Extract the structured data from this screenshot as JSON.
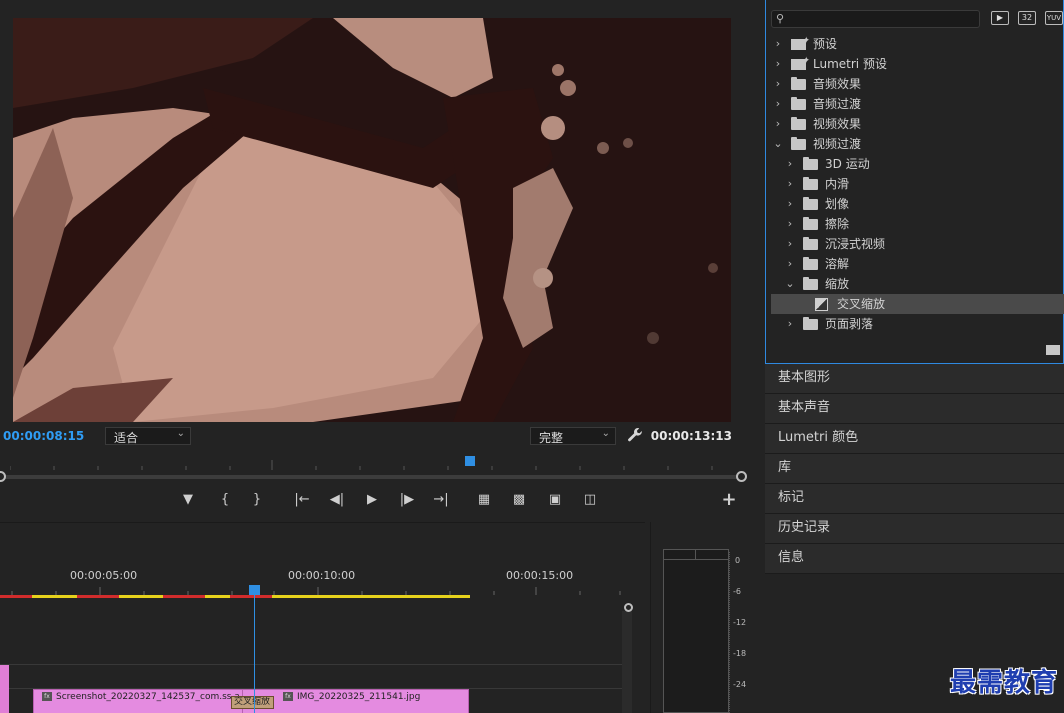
{
  "monitor": {
    "current_timecode": "00:00:08:15",
    "fit_select": "适合",
    "resolution_select": "完整",
    "duration_timecode": "00:00:13:13"
  },
  "controls": [
    "marker-icon",
    "mark-in-icon",
    "mark-out-icon",
    "go-to-in-icon",
    "step-back-icon",
    "play-icon",
    "step-forward-icon",
    "go-to-out-icon",
    "lift-icon",
    "extract-icon",
    "camera-icon",
    "compare-icon",
    "add-icon"
  ],
  "effects_panel": {
    "search_placeholder": "",
    "buttons": [
      "32-bit",
      "32",
      "YUV"
    ],
    "tree": [
      {
        "label": "预设",
        "expanded": false,
        "level": 0,
        "icon": "preset"
      },
      {
        "label": "Lumetri 预设",
        "expanded": false,
        "level": 0,
        "icon": "preset"
      },
      {
        "label": "音频效果",
        "expanded": false,
        "level": 0,
        "icon": "folder"
      },
      {
        "label": "音频过渡",
        "expanded": false,
        "level": 0,
        "icon": "folder"
      },
      {
        "label": "视频效果",
        "expanded": false,
        "level": 0,
        "icon": "folder"
      },
      {
        "label": "视频过渡",
        "expanded": true,
        "level": 0,
        "icon": "folder"
      },
      {
        "label": "3D 运动",
        "expanded": false,
        "level": 1,
        "icon": "folder"
      },
      {
        "label": "内滑",
        "expanded": false,
        "level": 1,
        "icon": "folder"
      },
      {
        "label": "划像",
        "expanded": false,
        "level": 1,
        "icon": "folder"
      },
      {
        "label": "擦除",
        "expanded": false,
        "level": 1,
        "icon": "folder"
      },
      {
        "label": "沉浸式视频",
        "expanded": false,
        "level": 1,
        "icon": "folder"
      },
      {
        "label": "溶解",
        "expanded": false,
        "level": 1,
        "icon": "folder"
      },
      {
        "label": "缩放",
        "expanded": true,
        "level": 1,
        "icon": "folder"
      },
      {
        "label": "交叉缩放",
        "expanded": null,
        "level": 2,
        "icon": "transition",
        "selected": true
      },
      {
        "label": "页面剥落",
        "expanded": false,
        "level": 1,
        "icon": "folder"
      }
    ]
  },
  "panels": [
    "基本图形",
    "基本声音",
    "Lumetri 颜色",
    "库",
    "标记",
    "历史记录",
    "信息"
  ],
  "timeline": {
    "times": [
      "00:00:05:00",
      "00:00:10:00",
      "00:00:15:00"
    ],
    "clips": {
      "clip1": "Screenshot_20220327_142537_com.ss.a",
      "transition": "交叉缩放",
      "clip2": "IMG_20220325_211541.jpg"
    }
  },
  "meter": {
    "db_labels": [
      "0",
      "-6",
      "-12",
      "-18",
      "-24"
    ]
  },
  "watermark": "最需教育"
}
